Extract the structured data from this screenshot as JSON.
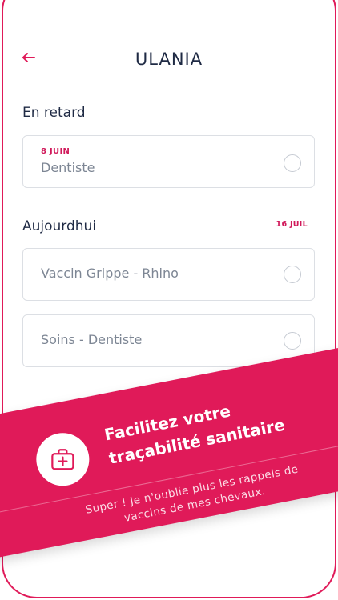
{
  "header": {
    "title": "ULANIA",
    "back_icon": "arrow-left-icon"
  },
  "overdue": {
    "title": "En retard",
    "items": [
      {
        "due": "8 JUIN",
        "label": "Dentiste"
      }
    ]
  },
  "today": {
    "title": "Aujourdhui",
    "date": "16 JUIL",
    "items": [
      {
        "label": "Vaccin Grippe - Rhino"
      },
      {
        "label": "Soins - Dentiste"
      }
    ]
  },
  "promo": {
    "icon": "first-aid-kit-icon",
    "headline_line1": "Facilitez votre",
    "headline_line2": "traçabilité sanitaire",
    "quote_line1": "Super ! Je n'oublie plus les rappels de",
    "quote_line2": "vaccins de mes chevaux."
  },
  "colors": {
    "accent": "#e01a59",
    "text_dark": "#1f2a44",
    "text_muted": "#7d8694",
    "border": "#dcdfe4"
  }
}
